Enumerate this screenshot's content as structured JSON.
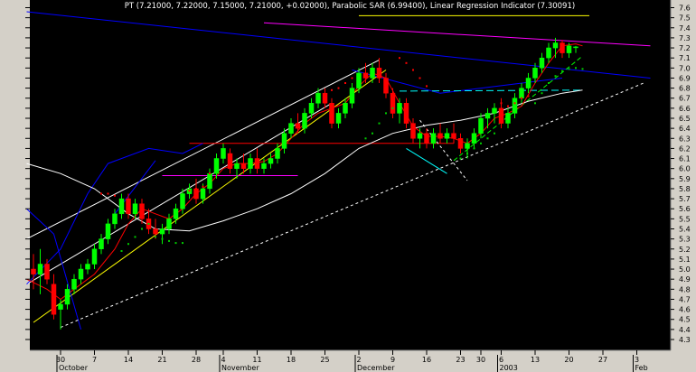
{
  "chart_data": {
    "type": "candlestick",
    "title": "PT (7.21000, 7.22000, 7.15000, 7.21000, +0.02000), Parabolic SAR (6.99400), Linear Regression Indicator (7.30091)",
    "xlabel": "",
    "ylabel": "",
    "ylim": [
      4.3,
      7.6
    ],
    "grid": false,
    "legend": "none",
    "y_ticks": [
      4.3,
      4.4,
      4.5,
      4.6,
      4.7,
      4.8,
      4.9,
      5.0,
      5.1,
      5.2,
      5.3,
      5.4,
      5.5,
      5.6,
      5.7,
      5.8,
      5.9,
      6.0,
      6.1,
      6.2,
      6.3,
      6.4,
      6.5,
      6.6,
      6.7,
      6.8,
      6.9,
      7.0,
      7.1,
      7.2,
      7.3,
      7.4,
      7.5,
      7.6
    ],
    "y_tick_labels": [
      "4.3",
      "4.4",
      "4.5",
      "4.6",
      "4.7",
      "4.8",
      "4.9",
      "5.0",
      "5.1",
      "5.2",
      "5.3",
      "5.4",
      "5.5",
      "5.6",
      "5.7",
      "5.8",
      "5.9",
      "6.0",
      "6.1",
      "6.2",
      "6.3",
      "6.4",
      "6.5",
      "6.6",
      "6.7",
      "6.8",
      "6.9",
      "7.0",
      "7.1",
      "7.2",
      "7.3",
      "7.4",
      "7.5",
      "7.6"
    ],
    "x_ticks": [
      {
        "i": 4,
        "label": "30"
      },
      {
        "i": 9,
        "label": "7"
      },
      {
        "i": 14,
        "label": "14"
      },
      {
        "i": 19,
        "label": "21"
      },
      {
        "i": 24,
        "label": "28"
      },
      {
        "i": 28,
        "label": "4"
      },
      {
        "i": 33,
        "label": "11"
      },
      {
        "i": 38,
        "label": "18"
      },
      {
        "i": 43,
        "label": "25"
      },
      {
        "i": 48,
        "label": "2"
      },
      {
        "i": 53,
        "label": "9"
      },
      {
        "i": 58,
        "label": "16"
      },
      {
        "i": 63,
        "label": "23"
      },
      {
        "i": 66,
        "label": "30"
      },
      {
        "i": 69,
        "label": "6"
      },
      {
        "i": 74,
        "label": "13"
      },
      {
        "i": 79,
        "label": "20"
      },
      {
        "i": 84,
        "label": "27"
      },
      {
        "i": 89,
        "label": "3"
      }
    ],
    "month_labels": [
      {
        "i": 4,
        "label": "October"
      },
      {
        "i": 28,
        "label": "November"
      },
      {
        "i": 48,
        "label": "December"
      },
      {
        "i": 69,
        "label": "2003"
      },
      {
        "i": 89,
        "label": "Feb"
      }
    ],
    "ohlc": [
      [
        5.0,
        5.15,
        4.8,
        4.95
      ],
      [
        4.95,
        5.2,
        4.75,
        5.05
      ],
      [
        5.05,
        5.1,
        4.85,
        4.9
      ],
      [
        4.85,
        4.95,
        4.5,
        4.55
      ],
      [
        4.6,
        4.7,
        4.4,
        4.65
      ],
      [
        4.65,
        4.85,
        4.6,
        4.8
      ],
      [
        4.8,
        4.95,
        4.75,
        4.9
      ],
      [
        4.9,
        5.05,
        4.85,
        5.0
      ],
      [
        5.0,
        5.1,
        4.95,
        5.05
      ],
      [
        5.05,
        5.25,
        5.0,
        5.2
      ],
      [
        5.2,
        5.35,
        5.15,
        5.3
      ],
      [
        5.3,
        5.5,
        5.25,
        5.45
      ],
      [
        5.45,
        5.6,
        5.4,
        5.55
      ],
      [
        5.55,
        5.75,
        5.5,
        5.7
      ],
      [
        5.7,
        5.75,
        5.5,
        5.55
      ],
      [
        5.55,
        5.7,
        5.5,
        5.65
      ],
      [
        5.65,
        5.7,
        5.45,
        5.5
      ],
      [
        5.5,
        5.6,
        5.35,
        5.4
      ],
      [
        5.4,
        5.5,
        5.3,
        5.35
      ],
      [
        5.35,
        5.45,
        5.25,
        5.4
      ],
      [
        5.4,
        5.55,
        5.35,
        5.5
      ],
      [
        5.5,
        5.65,
        5.45,
        5.6
      ],
      [
        5.6,
        5.8,
        5.55,
        5.75
      ],
      [
        5.75,
        5.85,
        5.7,
        5.8
      ],
      [
        5.8,
        5.9,
        5.65,
        5.7
      ],
      [
        5.7,
        5.85,
        5.65,
        5.8
      ],
      [
        5.8,
        6.0,
        5.75,
        5.95
      ],
      [
        5.95,
        6.15,
        5.9,
        6.1
      ],
      [
        6.1,
        6.25,
        6.05,
        6.2
      ],
      [
        6.15,
        6.2,
        5.95,
        6.0
      ],
      [
        6.0,
        6.1,
        5.9,
        6.05
      ],
      [
        6.05,
        6.15,
        5.95,
        6.0
      ],
      [
        6.0,
        6.15,
        5.95,
        6.1
      ],
      [
        6.1,
        6.2,
        5.95,
        6.0
      ],
      [
        6.0,
        6.1,
        5.95,
        6.05
      ],
      [
        6.05,
        6.15,
        6.0,
        6.1
      ],
      [
        6.1,
        6.25,
        6.05,
        6.2
      ],
      [
        6.2,
        6.4,
        6.15,
        6.35
      ],
      [
        6.35,
        6.5,
        6.3,
        6.45
      ],
      [
        6.45,
        6.55,
        6.35,
        6.4
      ],
      [
        6.4,
        6.6,
        6.35,
        6.55
      ],
      [
        6.55,
        6.7,
        6.5,
        6.65
      ],
      [
        6.65,
        6.8,
        6.6,
        6.75
      ],
      [
        6.75,
        6.8,
        6.6,
        6.65
      ],
      [
        6.65,
        6.7,
        6.4,
        6.45
      ],
      [
        6.45,
        6.6,
        6.4,
        6.55
      ],
      [
        6.55,
        6.7,
        6.5,
        6.65
      ],
      [
        6.65,
        6.85,
        6.6,
        6.8
      ],
      [
        6.8,
        7.0,
        6.75,
        6.95
      ],
      [
        6.95,
        7.05,
        6.85,
        6.9
      ],
      [
        6.9,
        7.05,
        6.85,
        7.0
      ],
      [
        7.0,
        7.1,
        6.85,
        6.9
      ],
      [
        6.9,
        6.95,
        6.7,
        6.75
      ],
      [
        6.75,
        6.8,
        6.5,
        6.55
      ],
      [
        6.55,
        6.7,
        6.45,
        6.65
      ],
      [
        6.65,
        6.7,
        6.4,
        6.45
      ],
      [
        6.45,
        6.5,
        6.25,
        6.3
      ],
      [
        6.3,
        6.4,
        6.2,
        6.35
      ],
      [
        6.35,
        6.4,
        6.2,
        6.25
      ],
      [
        6.25,
        6.4,
        6.2,
        6.35
      ],
      [
        6.35,
        6.45,
        6.25,
        6.3
      ],
      [
        6.3,
        6.4,
        6.25,
        6.35
      ],
      [
        6.35,
        6.45,
        6.25,
        6.3
      ],
      [
        6.3,
        6.35,
        6.15,
        6.2
      ],
      [
        6.2,
        6.3,
        6.1,
        6.25
      ],
      [
        6.25,
        6.4,
        6.2,
        6.35
      ],
      [
        6.35,
        6.55,
        6.3,
        6.5
      ],
      [
        6.5,
        6.6,
        6.4,
        6.55
      ],
      [
        6.55,
        6.65,
        6.45,
        6.6
      ],
      [
        6.6,
        6.7,
        6.4,
        6.45
      ],
      [
        6.45,
        6.6,
        6.4,
        6.55
      ],
      [
        6.55,
        6.75,
        6.5,
        6.7
      ],
      [
        6.7,
        6.85,
        6.65,
        6.8
      ],
      [
        6.8,
        6.95,
        6.75,
        6.9
      ],
      [
        6.9,
        7.05,
        6.85,
        7.0
      ],
      [
        7.0,
        7.15,
        6.95,
        7.1
      ],
      [
        7.1,
        7.25,
        7.05,
        7.2
      ],
      [
        7.2,
        7.3,
        7.1,
        7.25
      ],
      [
        7.25,
        7.28,
        7.1,
        7.15
      ],
      [
        7.15,
        7.25,
        7.1,
        7.22
      ],
      [
        7.21,
        7.22,
        7.15,
        7.21
      ]
    ],
    "series": [
      {
        "kind": "curve",
        "color": "#ffffff",
        "width": 1,
        "values": [
          [
            -1,
            6.05
          ],
          [
            4,
            5.95
          ],
          [
            9,
            5.8
          ],
          [
            14,
            5.55
          ],
          [
            18,
            5.4
          ],
          [
            23,
            5.38
          ],
          [
            28,
            5.48
          ],
          [
            33,
            5.6
          ],
          [
            38,
            5.75
          ],
          [
            43,
            5.95
          ],
          [
            48,
            6.2
          ],
          [
            53,
            6.35
          ],
          [
            58,
            6.43
          ],
          [
            63,
            6.48
          ],
          [
            68,
            6.55
          ],
          [
            73,
            6.67
          ],
          [
            78,
            6.75
          ],
          [
            81,
            6.78
          ]
        ]
      },
      {
        "kind": "curve",
        "color": "#ff0000",
        "width": 1,
        "values": [
          [
            -1,
            4.9
          ],
          [
            2,
            4.8
          ],
          [
            4,
            4.7
          ],
          [
            6,
            4.8
          ],
          [
            9,
            4.95
          ],
          [
            12,
            5.2
          ],
          [
            14,
            5.45
          ],
          [
            16,
            5.6
          ],
          [
            18,
            5.55
          ],
          [
            20,
            5.5
          ],
          [
            22,
            5.6
          ],
          [
            24,
            5.75
          ],
          [
            26,
            5.85
          ],
          [
            28,
            6.0
          ],
          [
            30,
            6.05
          ],
          [
            32,
            6.05
          ],
          [
            34,
            6.07
          ],
          [
            36,
            6.15
          ],
          [
            38,
            6.3
          ],
          [
            40,
            6.45
          ],
          [
            42,
            6.55
          ],
          [
            44,
            6.6
          ],
          [
            46,
            6.65
          ],
          [
            48,
            6.82
          ],
          [
            50,
            6.95
          ],
          [
            52,
            6.9
          ],
          [
            54,
            6.65
          ],
          [
            56,
            6.42
          ],
          [
            58,
            6.32
          ],
          [
            60,
            6.32
          ],
          [
            62,
            6.3
          ],
          [
            64,
            6.25
          ],
          [
            66,
            6.35
          ],
          [
            68,
            6.5
          ],
          [
            70,
            6.55
          ],
          [
            72,
            6.62
          ],
          [
            74,
            6.85
          ],
          [
            76,
            7.05
          ],
          [
            78,
            7.22
          ],
          [
            80,
            7.24
          ],
          [
            81,
            7.22
          ]
        ]
      },
      {
        "kind": "sar",
        "color": "#00cc00",
        "values": [
          [
            13,
            5.18
          ],
          [
            14,
            5.25
          ],
          [
            15,
            5.32
          ],
          [
            16,
            5.4
          ],
          [
            17,
            5.45
          ],
          [
            18,
            5.32
          ],
          [
            19,
            5.3
          ],
          [
            20,
            5.28
          ],
          [
            21,
            5.26
          ],
          [
            22,
            5.26
          ],
          [
            49,
            6.3
          ],
          [
            50,
            6.35
          ],
          [
            51,
            6.45
          ],
          [
            52,
            6.55
          ],
          [
            53,
            6.6
          ],
          [
            63,
            6.1
          ],
          [
            64,
            6.15
          ],
          [
            65,
            6.2
          ],
          [
            66,
            6.25
          ],
          [
            67,
            6.3
          ],
          [
            68,
            6.35
          ],
          [
            74,
            6.65
          ],
          [
            75,
            6.75
          ],
          [
            76,
            6.85
          ],
          [
            77,
            6.92
          ],
          [
            78,
            6.97
          ],
          [
            79,
            6.99
          ],
          [
            80,
            7.0
          ],
          [
            81,
            6.99
          ]
        ]
      },
      {
        "kind": "sar",
        "color": "#ff0000",
        "values": [
          [
            10,
            5.75
          ],
          [
            11,
            5.75
          ],
          [
            12,
            5.73
          ],
          [
            23,
            5.78
          ],
          [
            24,
            5.8
          ],
          [
            25,
            5.82
          ],
          [
            26,
            5.95
          ],
          [
            44,
            6.78
          ],
          [
            45,
            6.8
          ],
          [
            46,
            6.85
          ],
          [
            47,
            6.9
          ],
          [
            54,
            7.1
          ],
          [
            55,
            7.05
          ],
          [
            56,
            6.98
          ],
          [
            57,
            6.9
          ],
          [
            58,
            6.82
          ],
          [
            69,
            6.65
          ],
          [
            70,
            6.62
          ],
          [
            71,
            6.65
          ],
          [
            72,
            6.7
          ],
          [
            73,
            6.72
          ]
        ]
      }
    ],
    "lines": [
      {
        "color": "#ffffff",
        "width": 1,
        "dash": "",
        "points": [
          [
            -1,
            5.3
          ],
          [
            51,
            7.08
          ]
        ]
      },
      {
        "color": "#ffffff",
        "width": 1,
        "dash": "",
        "points": [
          [
            -1,
            4.85
          ],
          [
            44,
            6.65
          ]
        ]
      },
      {
        "color": "#ffff00",
        "width": 1,
        "dash": "",
        "points": [
          [
            0,
            4.47
          ],
          [
            52,
            6.98
          ]
        ]
      },
      {
        "color": "#ffff00",
        "width": 1,
        "dash": "",
        "points": [
          [
            48,
            7.52
          ],
          [
            82,
            7.52
          ]
        ]
      },
      {
        "color": "#ff00ff",
        "width": 1,
        "dash": "",
        "points": [
          [
            34,
            7.45
          ],
          [
            91,
            7.22
          ]
        ]
      },
      {
        "color": "#ff00ff",
        "width": 1,
        "dash": "",
        "points": [
          [
            19,
            5.93
          ],
          [
            39,
            5.93
          ]
        ]
      },
      {
        "color": "#ff0000",
        "width": 1,
        "dash": "",
        "points": [
          [
            23,
            6.25
          ],
          [
            62,
            6.25
          ]
        ]
      },
      {
        "color": "#0000ff",
        "width": 1,
        "dash": "",
        "points": [
          [
            -1,
            7.56
          ],
          [
            91,
            6.9
          ]
        ]
      },
      {
        "color": "#0000ff",
        "width": 1,
        "dash": "",
        "points": [
          [
            -1,
            4.85
          ],
          [
            4,
            5.2
          ],
          [
            8,
            5.75
          ],
          [
            11,
            6.05
          ],
          [
            17,
            6.2
          ],
          [
            22,
            6.15
          ],
          [
            25,
            6.25
          ]
        ]
      },
      {
        "color": "#0000ff",
        "width": 1,
        "dash": "",
        "points": [
          [
            -1,
            5.6
          ],
          [
            3,
            5.35
          ],
          [
            7,
            4.4
          ]
        ]
      },
      {
        "color": "#0000ff",
        "width": 1,
        "dash": "",
        "points": [
          [
            12,
            5.55
          ],
          [
            18,
            6.08
          ]
        ]
      },
      {
        "color": "#0000ff",
        "width": 1,
        "dash": "",
        "points": [
          [
            47,
            6.98
          ],
          [
            60,
            6.75
          ],
          [
            78,
            6.9
          ]
        ]
      },
      {
        "color": "#00ffff",
        "width": 1,
        "dash": "",
        "points": [
          [
            55,
            6.2
          ],
          [
            61,
            5.95
          ]
        ]
      },
      {
        "color": "#00ffff",
        "width": 1,
        "dash": "8,4",
        "points": [
          [
            54,
            6.77
          ],
          [
            81,
            6.78
          ]
        ]
      },
      {
        "color": "#00ff00",
        "width": 1,
        "dash": "5,3",
        "points": [
          [
            62,
            6.08
          ],
          [
            81,
            7.12
          ]
        ]
      },
      {
        "color": "#ffffff",
        "width": 1,
        "dash": "3,3",
        "points": [
          [
            4,
            4.42
          ],
          [
            90,
            6.85
          ]
        ]
      },
      {
        "color": "#ffffff",
        "width": 1,
        "dash": "3,3",
        "points": [
          [
            57,
            6.48
          ],
          [
            64,
            5.88
          ]
        ]
      }
    ]
  }
}
